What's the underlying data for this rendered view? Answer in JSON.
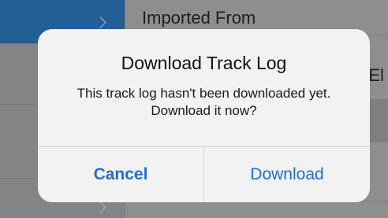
{
  "background": {
    "header_text": "Imported From",
    "row_text": "-El"
  },
  "alert": {
    "title": "Download Track Log",
    "message": "This track log hasn't been downloaded yet. Download it now?",
    "cancel_label": "Cancel",
    "download_label": "Download"
  },
  "colors": {
    "accent": "#1f6fd1",
    "sidebar_selected": "#235e94",
    "alert_background": "#f2f2f2"
  }
}
